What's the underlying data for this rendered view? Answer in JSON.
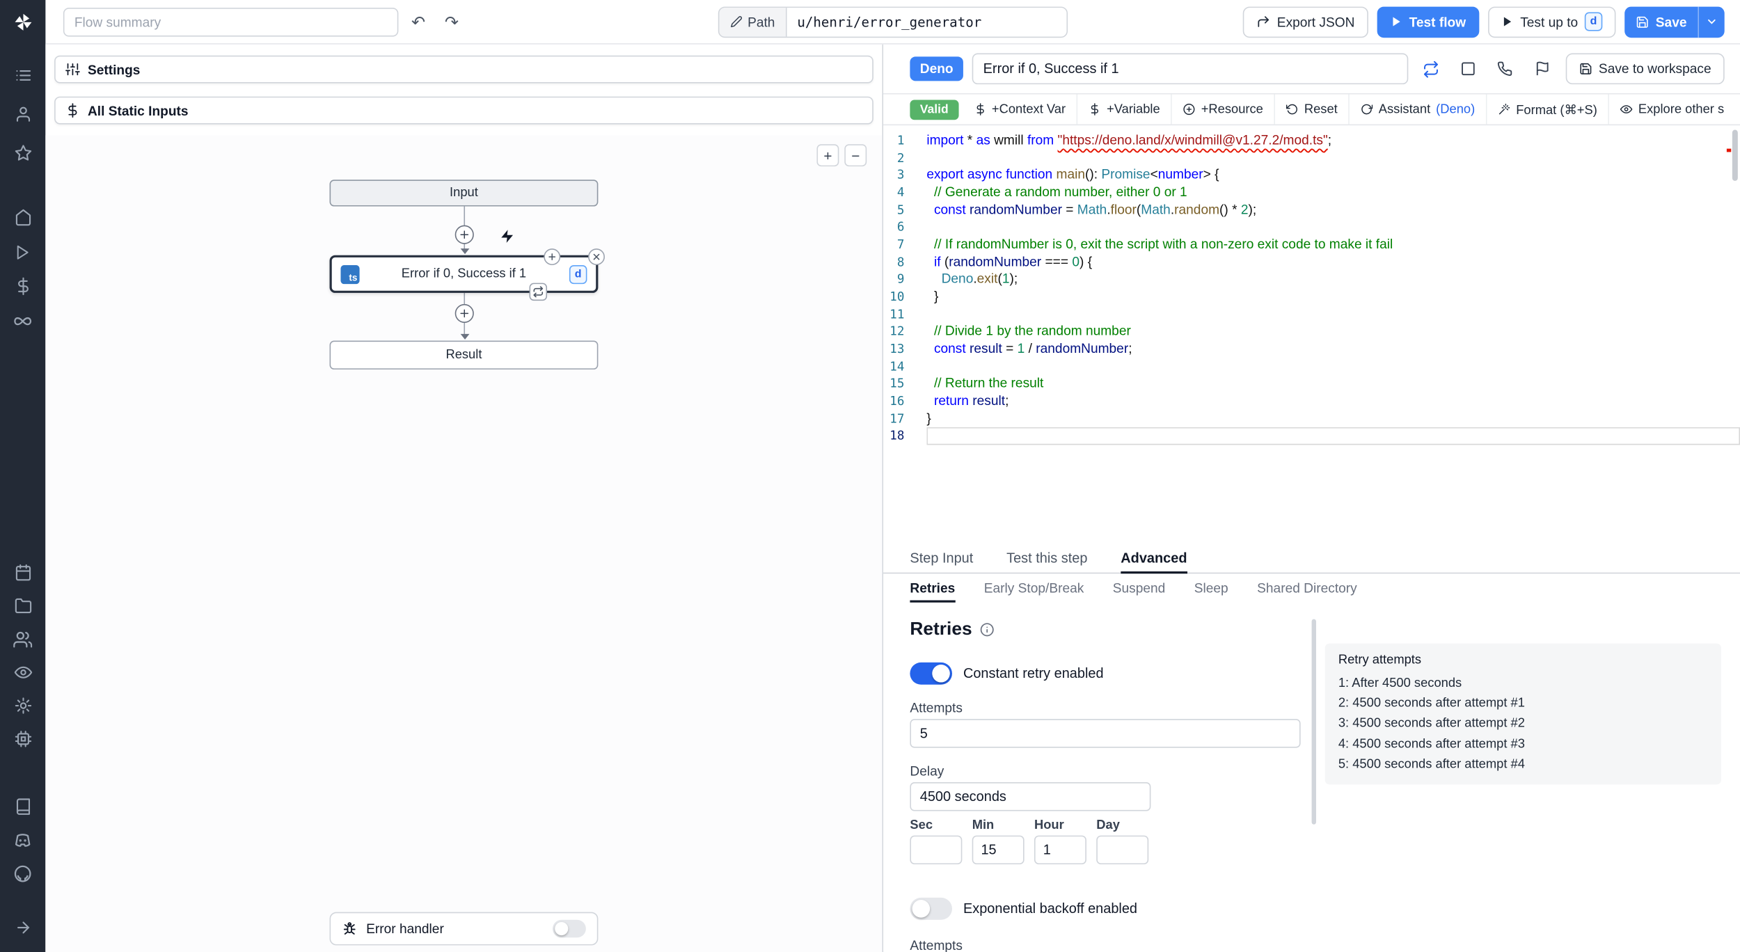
{
  "colors": {
    "accent": "#3b82f6",
    "valid_green": "#57b368",
    "sidebar_bg": "#232a36",
    "deno_badge": "#3b82f6",
    "ts_badge": "#3178c6"
  },
  "icon_names": [
    "windmill-logo",
    "scripts-icon",
    "user-icon",
    "star-icon",
    "home-icon",
    "play-icon",
    "dollar-icon",
    "resources-icon",
    "calendar-icon",
    "folder-icon",
    "users-icon",
    "eye-icon",
    "gear-icon",
    "workers-icon",
    "book-icon",
    "discord-icon",
    "github-icon",
    "arrow-right-icon",
    "undo-icon",
    "redo-icon",
    "pencil-icon",
    "export-icon",
    "chevron-down-icon",
    "save-icon",
    "sliders-icon",
    "plus-circle-icon",
    "bolt-icon",
    "close-circle-icon",
    "retry-loop-icon",
    "bug-icon",
    "sync-icon",
    "window-icon",
    "phone-icon",
    "flag-icon",
    "info-icon",
    "zoom-in-icon",
    "zoom-out-icon"
  ],
  "topbar": {
    "flow_summary_placeholder": "Flow summary",
    "path_label": "Path",
    "path_value": "u/henri/error_generator",
    "export_json_label": "Export JSON",
    "test_flow_label": "Test flow",
    "test_up_to_label": "Test up to",
    "test_up_to_badge": "d",
    "save_label": "Save"
  },
  "flow": {
    "settings_label": "Settings",
    "static_inputs_label": "All Static Inputs",
    "zoom_in": "+",
    "zoom_out": "−",
    "input_node": "Input",
    "step_node_title": "Error if 0, Success if 1",
    "step_lang_badge": "ts",
    "step_suffix_badge": "d",
    "result_node": "Result",
    "error_handler_label": "Error handler"
  },
  "editor": {
    "lang_badge": "Deno",
    "title_value": "Error if 0, Success if 1",
    "save_to_workspace_label": "Save to workspace",
    "toolbar": {
      "valid": "Valid",
      "context_var": "+Context Var",
      "variable": "+Variable",
      "resource": "+Resource",
      "reset": "Reset",
      "assistant": "Assistant",
      "assistant_lang": "(Deno)",
      "format": "Format (⌘+S)",
      "explore": "Explore other s"
    },
    "code": {
      "lines": [
        {
          "n": 1,
          "t": [
            [
              "k",
              "import"
            ],
            [
              "p",
              " * "
            ],
            [
              "k",
              "as"
            ],
            [
              "p",
              " wmill "
            ],
            [
              "k",
              "from"
            ],
            [
              "p",
              " "
            ],
            [
              "su",
              "\"https://deno.land/x/windmill@v1.27.2/mod.ts\""
            ],
            [
              "p",
              ";"
            ]
          ]
        },
        {
          "n": 2,
          "t": []
        },
        {
          "n": 3,
          "t": [
            [
              "k",
              "export"
            ],
            [
              "p",
              " "
            ],
            [
              "k",
              "async"
            ],
            [
              "p",
              " "
            ],
            [
              "k",
              "function"
            ],
            [
              "p",
              " "
            ],
            [
              "f",
              "main"
            ],
            [
              "p",
              "(): "
            ],
            [
              "t",
              "Promise"
            ],
            [
              "p",
              "<"
            ],
            [
              "k",
              "number"
            ],
            [
              "p",
              "> {"
            ]
          ]
        },
        {
          "n": 4,
          "t": [
            [
              "c",
              "  // Generate a random number, either 0 or 1"
            ]
          ]
        },
        {
          "n": 5,
          "t": [
            [
              "p",
              "  "
            ],
            [
              "k",
              "const"
            ],
            [
              "p",
              " "
            ],
            [
              "v",
              "randomNumber"
            ],
            [
              "p",
              " = "
            ],
            [
              "t",
              "Math"
            ],
            [
              "p",
              "."
            ],
            [
              "f",
              "floor"
            ],
            [
              "p",
              "("
            ],
            [
              "t",
              "Math"
            ],
            [
              "p",
              "."
            ],
            [
              "f",
              "random"
            ],
            [
              "p",
              "() * "
            ],
            [
              "n",
              "2"
            ],
            [
              "p",
              ");"
            ]
          ]
        },
        {
          "n": 6,
          "t": []
        },
        {
          "n": 7,
          "t": [
            [
              "c",
              "  // If randomNumber is 0, exit the script with a non-zero exit code to make it fail"
            ]
          ]
        },
        {
          "n": 8,
          "t": [
            [
              "p",
              "  "
            ],
            [
              "k",
              "if"
            ],
            [
              "p",
              " ("
            ],
            [
              "v",
              "randomNumber"
            ],
            [
              "p",
              " === "
            ],
            [
              "n",
              "0"
            ],
            [
              "p",
              ") {"
            ]
          ]
        },
        {
          "n": 9,
          "t": [
            [
              "p",
              "    "
            ],
            [
              "t",
              "Deno"
            ],
            [
              "p",
              "."
            ],
            [
              "f",
              "exit"
            ],
            [
              "p",
              "("
            ],
            [
              "n",
              "1"
            ],
            [
              "p",
              ");"
            ]
          ]
        },
        {
          "n": 10,
          "t": [
            [
              "p",
              "  }"
            ]
          ]
        },
        {
          "n": 11,
          "t": []
        },
        {
          "n": 12,
          "t": [
            [
              "c",
              "  // Divide 1 by the random number"
            ]
          ]
        },
        {
          "n": 13,
          "t": [
            [
              "p",
              "  "
            ],
            [
              "k",
              "const"
            ],
            [
              "p",
              " "
            ],
            [
              "v",
              "result"
            ],
            [
              "p",
              " = "
            ],
            [
              "n",
              "1"
            ],
            [
              "p",
              " / "
            ],
            [
              "v",
              "randomNumber"
            ],
            [
              "p",
              ";"
            ]
          ]
        },
        {
          "n": 14,
          "t": []
        },
        {
          "n": 15,
          "t": [
            [
              "c",
              "  // Return the result"
            ]
          ]
        },
        {
          "n": 16,
          "t": [
            [
              "p",
              "  "
            ],
            [
              "k",
              "return"
            ],
            [
              "p",
              " "
            ],
            [
              "v",
              "result"
            ],
            [
              "p",
              ";"
            ]
          ]
        },
        {
          "n": 17,
          "t": [
            [
              "p",
              "}"
            ]
          ]
        },
        {
          "n": 18,
          "t": [],
          "a": true
        }
      ]
    }
  },
  "panel": {
    "tabs": [
      "Step Input",
      "Test this step",
      "Advanced"
    ],
    "subtabs": [
      "Retries",
      "Early Stop/Break",
      "Suspend",
      "Sleep",
      "Shared Directory"
    ],
    "retries": {
      "heading": "Retries",
      "constant_label": "Constant retry enabled",
      "attempts_label": "Attempts",
      "attempts_value": "5",
      "delay_label": "Delay",
      "delay_value": "4500 seconds",
      "time": [
        {
          "label": "Sec",
          "value": ""
        },
        {
          "label": "Min",
          "value": "15"
        },
        {
          "label": "Hour",
          "value": "1"
        },
        {
          "label": "Day",
          "value": ""
        }
      ],
      "exponential_label": "Exponential backoff enabled",
      "attempts_cut_label": "Attempts",
      "summary_title": "Retry attempts",
      "summary_items": [
        "1:  After 4500 seconds",
        "2:  4500 seconds after attempt #1",
        "3:  4500 seconds after attempt #2",
        "4:  4500 seconds after attempt #3",
        "5:  4500 seconds after attempt #4"
      ]
    }
  }
}
